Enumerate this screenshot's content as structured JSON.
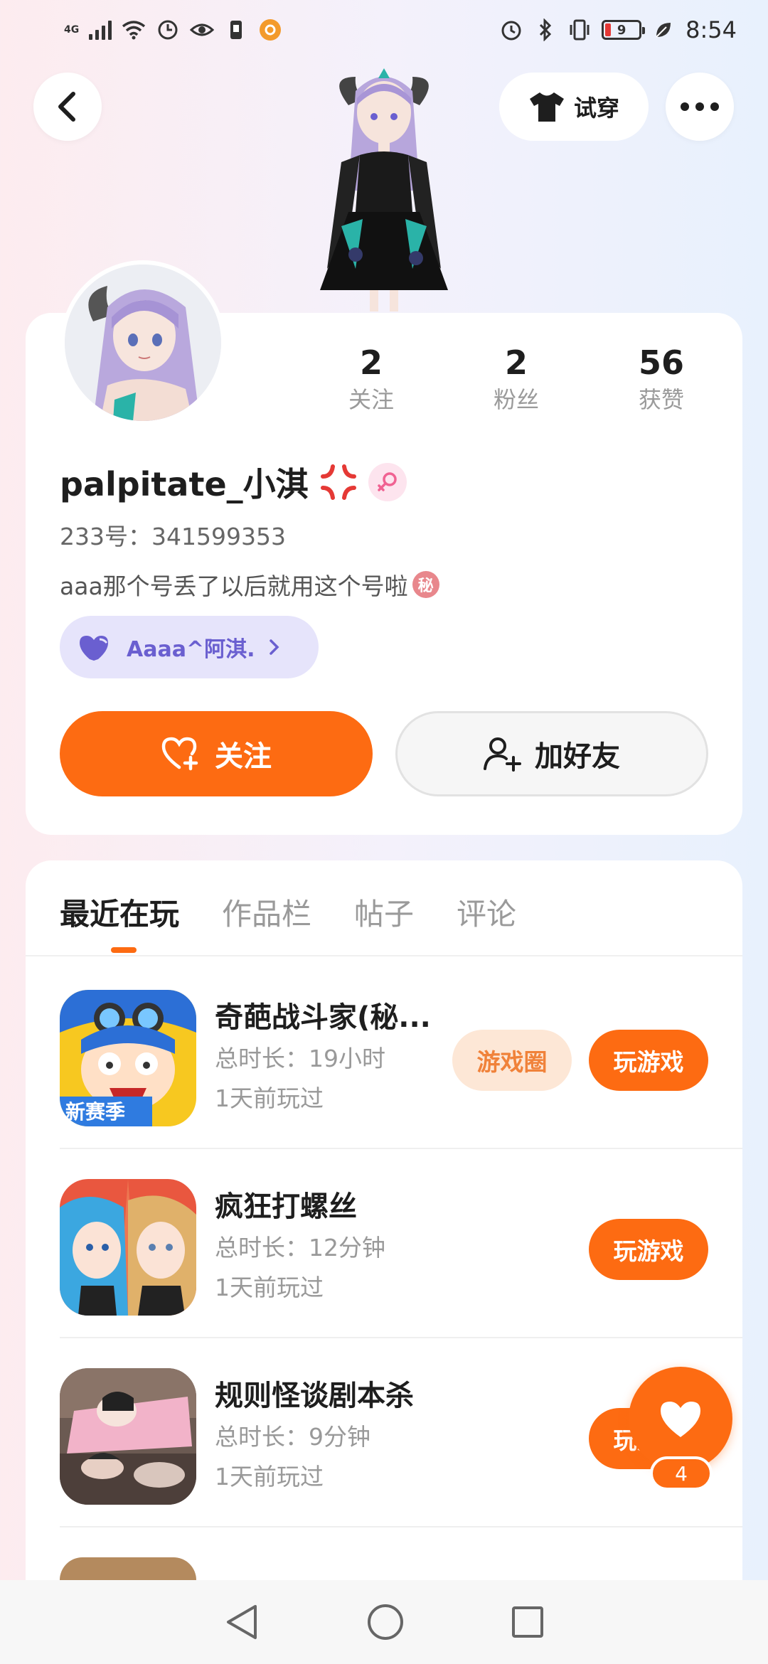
{
  "status_bar": {
    "network": "4G",
    "time": "8:54",
    "battery_level": "9",
    "icons": [
      "signal-icon",
      "wifi-icon",
      "data-saver-icon",
      "eye-icon",
      "sim-icon",
      "app-notify-icon",
      "alarm-icon",
      "bluetooth-icon",
      "vibrate-icon",
      "battery-icon",
      "leaf-icon"
    ]
  },
  "header": {
    "back_icon": "back-arrow-icon",
    "tryon_label": "试穿",
    "tryon_icon": "tshirt-icon",
    "more_icon": "more-dots-icon"
  },
  "profile": {
    "stats": [
      {
        "value": "2",
        "label": "关注"
      },
      {
        "value": "2",
        "label": "粉丝"
      },
      {
        "value": "56",
        "label": "获赞"
      }
    ],
    "username": "palpitate_小淇",
    "uid": "233号：341599353",
    "bio": "aaa那个号丢了以后就用这个号啦",
    "bio_badge": "秘",
    "fan_chip_label": "Aaaa^阿淇.",
    "follow_label": "关注",
    "add_friend_label": "加好友",
    "accent": "#fd6b12"
  },
  "tabs": [
    {
      "label": "最近在玩",
      "active": true
    },
    {
      "label": "作品栏",
      "active": false
    },
    {
      "label": "帖子",
      "active": false
    },
    {
      "label": "评论",
      "active": false
    }
  ],
  "games": [
    {
      "name": "奇葩战斗家(秘...",
      "duration": "总时长：19小时",
      "last_played": "1天前玩过",
      "circle_label": "游戏圈",
      "play_label": "玩游戏",
      "icon_tag": "新赛季"
    },
    {
      "name": "疯狂打螺丝",
      "duration": "总时长：12分钟",
      "last_played": "1天前玩过",
      "play_label": "玩游戏"
    },
    {
      "name": "规则怪谈剧本杀",
      "duration": "总时长：9分钟",
      "last_played": "1天前玩过",
      "play_label": "玩游戏"
    }
  ],
  "like_fab": {
    "count": "4"
  },
  "nav": {
    "icons": [
      "back-triangle-icon",
      "home-circle-icon",
      "recents-square-icon"
    ]
  }
}
